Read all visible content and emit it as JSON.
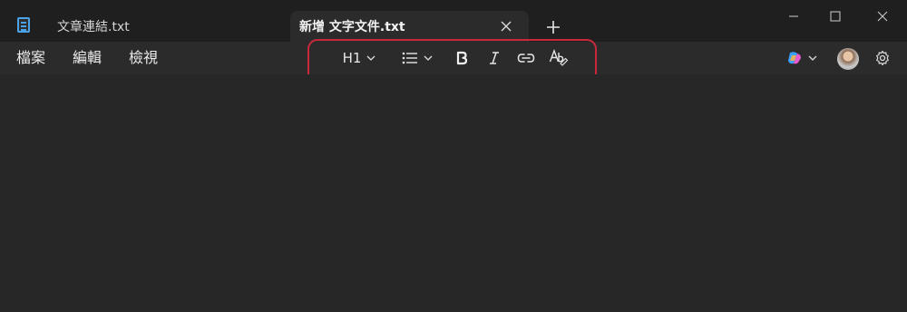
{
  "tabs": [
    {
      "label": "文章連結.txt",
      "active": false
    },
    {
      "label": "新增 文字文件.txt",
      "active": true
    }
  ],
  "menu": {
    "file": "檔案",
    "edit": "編輯",
    "view": "檢視"
  },
  "toolbar": {
    "heading_label": "H1"
  },
  "icons": {
    "app": "notepad-icon",
    "tab_close": "close-icon",
    "new_tab": "plus-icon",
    "list": "bulleted-list-icon",
    "bold": "bold-icon",
    "italic": "italic-icon",
    "link": "link-icon",
    "clear_format": "clear-formatting-icon",
    "copilot": "copilot-icon",
    "settings": "gear-icon"
  },
  "colors": {
    "highlight": "#c8283a",
    "accent": "#4aa3e8"
  }
}
